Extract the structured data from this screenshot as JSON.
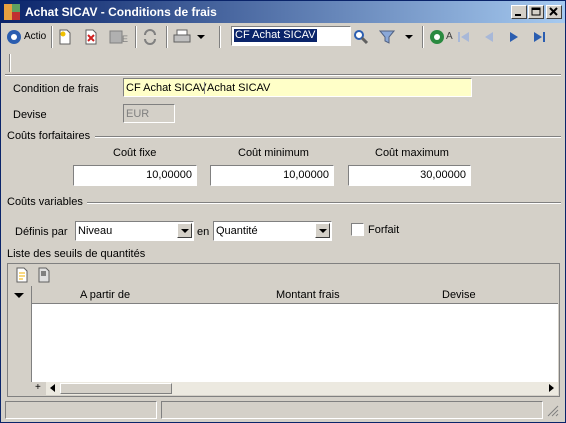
{
  "window": {
    "title": "Achat SICAV - Conditions de frais"
  },
  "toolbar": {
    "action_label": "Actio",
    "search_value": "CF Achat SICAV",
    "nav_label": "A"
  },
  "form": {
    "condition_label": "Condition de frais",
    "condition_code": "CF Achat SICAV",
    "condition_name": "Achat SICAV",
    "devise_label": "Devise",
    "devise_value": "EUR"
  },
  "couts_forfaitaires": {
    "title": "Coûts forfaitaires",
    "fixe_label": "Coût fixe",
    "fixe_value": "10,00000",
    "min_label": "Coût minimum",
    "min_value": "10,00000",
    "max_label": "Coût maximum",
    "max_value": "30,00000"
  },
  "couts_variables": {
    "title": "Coûts variables",
    "definis_label": "Définis par",
    "definis_value": "Niveau",
    "en_label": "en",
    "en_value": "Quantité",
    "forfait_label": "Forfait"
  },
  "seuils": {
    "title": "Liste des seuils de quantités",
    "columns": [
      "A partir de",
      "Montant frais",
      "Devise"
    ],
    "add_symbol": "+"
  }
}
